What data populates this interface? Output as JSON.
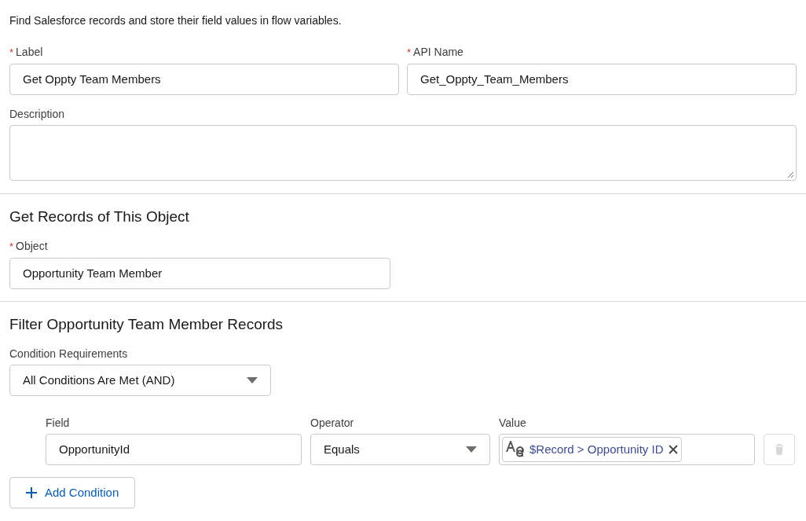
{
  "intro": "Find Salesforce records and store their field values in flow variables.",
  "label_field": {
    "label": "Label",
    "required_mark": "*",
    "value": "Get Oppty Team Members"
  },
  "api_name_field": {
    "label": "API Name",
    "required_mark": "*",
    "value": "Get_Oppty_Team_Members"
  },
  "description_field": {
    "label": "Description"
  },
  "object_section": {
    "title": "Get Records of This Object",
    "field": {
      "label": "Object",
      "required_mark": "*",
      "value": "Opportunity Team Member"
    }
  },
  "filter_section": {
    "title": "Filter Opportunity Team Member Records",
    "requirements": {
      "label": "Condition Requirements",
      "value": "All Conditions Are Met (AND)"
    },
    "columns": [
      "Field",
      "Operator",
      "Value"
    ],
    "conditions": [
      {
        "field": "OpportunityId",
        "operator": "Equals",
        "value_pill": "$Record > Opportunity ID",
        "delete_disabled": true
      }
    ],
    "add_button": "Add Condition"
  }
}
